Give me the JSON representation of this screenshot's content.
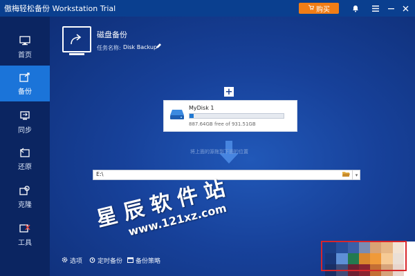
{
  "window": {
    "title": "傲梅轻松备份 Workstation Trial",
    "buy_label": "购买"
  },
  "sidebar": {
    "items": [
      {
        "label": "首页",
        "icon": "monitor-icon"
      },
      {
        "label": "备份",
        "icon": "backup-icon"
      },
      {
        "label": "同步",
        "icon": "sync-icon"
      },
      {
        "label": "还原",
        "icon": "restore-icon"
      },
      {
        "label": "克隆",
        "icon": "clone-icon"
      },
      {
        "label": "工具",
        "icon": "tools-icon"
      }
    ],
    "active_index": 1
  },
  "task": {
    "title": "磁盘备份",
    "name_label": "任务名称:",
    "name_value": "Disk Backup"
  },
  "source": {
    "disk_name": "MyDisk 1",
    "free_text": "887.64GB free of 931.51GB",
    "used_fraction": 0.047
  },
  "destination": {
    "hint": "将上面的源拖到下面的位置",
    "path": "E:\\"
  },
  "footer": {
    "options": "选项",
    "schedule": "定时备份",
    "strategy": "备份策略"
  },
  "watermark": {
    "text_cn": "星辰软件站",
    "url": "www.121xz.com"
  },
  "colors": {
    "accent": "#1b74d9",
    "buy": "#f07d16",
    "sidebar": "#0b2561",
    "titlebar": "#0a3f8f",
    "highlight_frame": "#d8262a"
  }
}
